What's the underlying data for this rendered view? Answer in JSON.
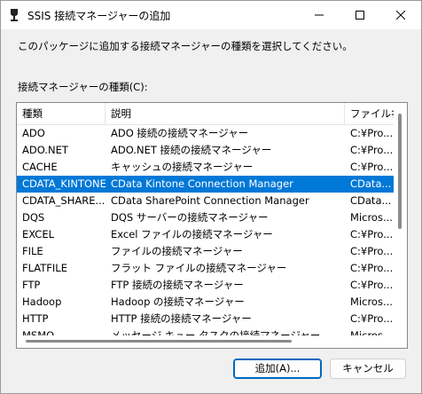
{
  "window": {
    "title": "SSIS 接続マネージャーの追加",
    "icon": "database-icon"
  },
  "prompt": "このパッケージに追加する接続マネージャーの種類を選択してください。",
  "list": {
    "label": "接続マネージャーの種類(C):",
    "columns": [
      "種類",
      "説明",
      "ファイル名"
    ],
    "rows": [
      {
        "type": "ADO",
        "desc": "ADO 接続の接続マネージャー",
        "file": "C:¥Pro..."
      },
      {
        "type": "ADO.NET",
        "desc": "ADO.NET 接続の接続マネージャー",
        "file": "C:¥Pro..."
      },
      {
        "type": "CACHE",
        "desc": "キャッシュの接続マネージャー",
        "file": "C:¥Pro..."
      },
      {
        "type": "CDATA_KINTONE",
        "desc": "CData Kintone Connection Manager",
        "file": "CData..."
      },
      {
        "type": "CDATA_SHARE...",
        "desc": "CData SharePoint Connection Manager",
        "file": "CData..."
      },
      {
        "type": "DQS",
        "desc": "DQS サーバーの接続マネージャー",
        "file": "Micros..."
      },
      {
        "type": "EXCEL",
        "desc": "Excel ファイルの接続マネージャー",
        "file": "C:¥Pro..."
      },
      {
        "type": "FILE",
        "desc": "ファイルの接続マネージャー",
        "file": "C:¥Pro..."
      },
      {
        "type": "FLATFILE",
        "desc": "フラット ファイルの接続マネージャー",
        "file": "C:¥Pro..."
      },
      {
        "type": "FTP",
        "desc": "FTP 接続の接続マネージャー",
        "file": "C:¥Pro..."
      },
      {
        "type": "Hadoop",
        "desc": "Hadoop の接続マネージャー",
        "file": "Micros..."
      },
      {
        "type": "HTTP",
        "desc": "HTTP 接続の接続マネージャー",
        "file": "C:¥Pro..."
      },
      {
        "type": "MSMQ",
        "desc": "メッセージ キュー タスクの接続マネージャー",
        "file": "Micros..."
      }
    ],
    "selected_index": 3
  },
  "buttons": {
    "add": "追加(A)...",
    "cancel": "キャンセル"
  },
  "colors": {
    "selection": "#0078d7"
  }
}
